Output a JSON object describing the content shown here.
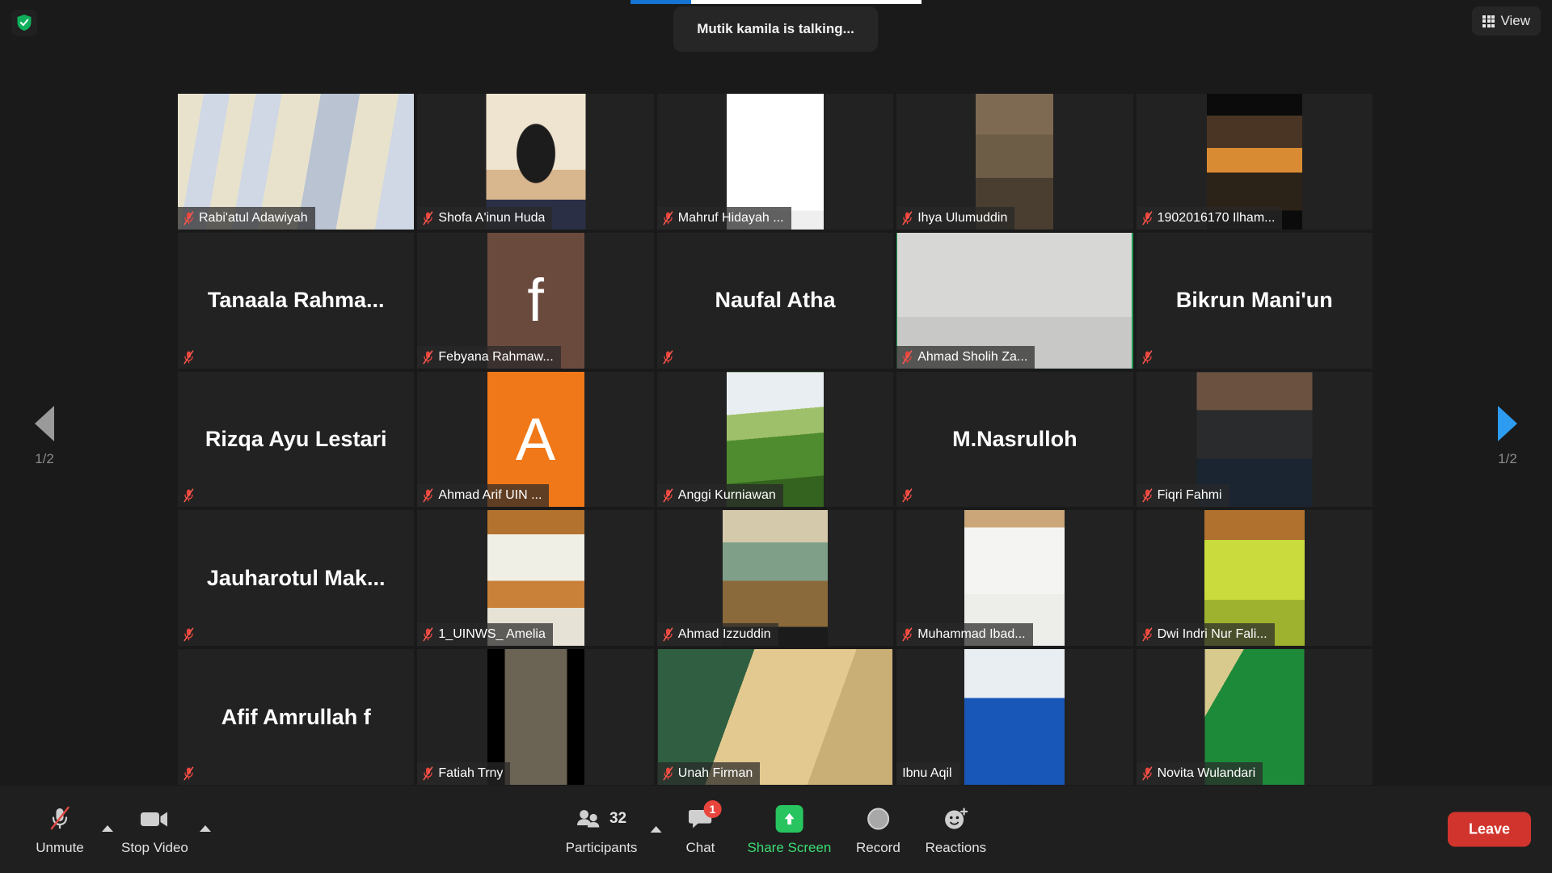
{
  "header": {
    "talking_notice": "Mutik kamila is talking...",
    "view_label": "View",
    "shield_icon": "security-shield-icon",
    "grid_icon": "grid-view-icon"
  },
  "navigation": {
    "prev_page_label": "1/2",
    "next_page_label": "1/2",
    "prev_icon": "triangle-left-icon",
    "next_icon": "triangle-right-icon"
  },
  "colors": {
    "accent_blue": "#2d9cf0",
    "share_green": "#27c460",
    "leave_red": "#d0342c",
    "mute_red": "#e8453c",
    "tile_bg": "#222222",
    "app_bg": "#1a1a1a",
    "toolbar_bg": "#1f1f1f"
  },
  "participants": [
    {
      "name": "Rabi'atul Adawiyah",
      "video": true,
      "muted": true,
      "speaking": false,
      "style": "photo-person-a",
      "media_w": 292,
      "name_truncated": false
    },
    {
      "name": "Shofa A'inun Huda",
      "video": true,
      "muted": true,
      "speaking": false,
      "style": "photo-person-b",
      "media_w": 123,
      "name_truncated": false
    },
    {
      "name": "Mahruf Hidayah ...",
      "video": true,
      "muted": true,
      "speaking": false,
      "style": "photo-doc-white",
      "media_w": 120,
      "name_truncated": true
    },
    {
      "name": "Ihya Ulumuddin",
      "video": true,
      "muted": true,
      "speaking": false,
      "style": "photo-outdoor-sit",
      "media_w": 96,
      "name_truncated": false
    },
    {
      "name": "1902016170 Ilham...",
      "video": true,
      "muted": true,
      "speaking": false,
      "style": "photo-sunset",
      "media_w": 118,
      "name_truncated": true
    },
    {
      "name": "Tanaala  Rahma...",
      "video": false,
      "muted": true,
      "speaking": false,
      "style": "name-only",
      "media_w": 0,
      "name_truncated": true
    },
    {
      "name": "Febyana Rahmaw...",
      "video": false,
      "muted": true,
      "speaking": false,
      "style": "avatar-letter-f",
      "avatar_letter": "f",
      "avatar_color": "#6b4a3e",
      "media_w": 120,
      "name_truncated": true
    },
    {
      "name": "Naufal Atha",
      "video": false,
      "muted": true,
      "speaking": false,
      "style": "name-only",
      "media_w": 0,
      "name_truncated": false
    },
    {
      "name": "Ahmad Sholih Za...",
      "video": true,
      "muted": true,
      "speaking": true,
      "style": "photo-person-cap",
      "media_w": 290,
      "name_truncated": true
    },
    {
      "name": "Bikrun Mani'un",
      "video": false,
      "muted": true,
      "speaking": false,
      "style": "name-only",
      "media_w": 0,
      "name_truncated": false
    },
    {
      "name": "Rizqa Ayu Lestari",
      "video": false,
      "muted": true,
      "speaking": false,
      "style": "name-only",
      "media_w": 0,
      "name_truncated": false
    },
    {
      "name": "Ahmad Arif UIN ...",
      "video": false,
      "muted": true,
      "speaking": false,
      "style": "avatar-letter-a",
      "avatar_letter": "A",
      "avatar_color": "#f07818",
      "media_w": 120,
      "name_truncated": true
    },
    {
      "name": "Anggi Kurniawan",
      "video": true,
      "muted": true,
      "speaking": false,
      "style": "photo-green-hill",
      "media_w": 120,
      "name_truncated": false
    },
    {
      "name": "M.Nasrulloh",
      "video": false,
      "muted": true,
      "speaking": false,
      "style": "name-only",
      "media_w": 0,
      "name_truncated": false
    },
    {
      "name": "Fiqri Fahmi",
      "video": true,
      "muted": true,
      "speaking": false,
      "style": "photo-study-boy",
      "media_w": 143,
      "name_truncated": false
    },
    {
      "name": "Jauharotul  Mak...",
      "video": false,
      "muted": true,
      "speaking": false,
      "style": "name-only",
      "media_w": 0,
      "name_truncated": true
    },
    {
      "name": "1_UINWS_ Amelia",
      "video": true,
      "muted": true,
      "speaking": false,
      "style": "photo-flowers",
      "media_w": 120,
      "name_truncated": false
    },
    {
      "name": "Ahmad Izzuddin",
      "video": true,
      "muted": true,
      "speaking": false,
      "style": "photo-tv-broadcast",
      "media_w": 130,
      "name_truncated": false
    },
    {
      "name": "Muhammad Ibad...",
      "video": true,
      "muted": true,
      "speaking": false,
      "style": "photo-white-room",
      "media_w": 124,
      "name_truncated": true
    },
    {
      "name": "Dwi Indri Nur Fali...",
      "video": true,
      "muted": true,
      "speaking": false,
      "style": "photo-pink-hijab",
      "media_w": 124,
      "name_truncated": true
    },
    {
      "name": "Afif Amrullah f",
      "video": false,
      "muted": true,
      "speaking": false,
      "style": "name-only",
      "media_w": 0,
      "name_truncated": false
    },
    {
      "name": "Fatiah Trny",
      "video": true,
      "muted": true,
      "speaking": false,
      "style": "photo-dark-portrait",
      "media_w": 120,
      "name_truncated": false
    },
    {
      "name": "Unah Firman",
      "video": true,
      "muted": true,
      "speaking": false,
      "style": "photo-green-wall",
      "media_w": 290,
      "name_truncated": false
    },
    {
      "name": "Ibnu Aqil",
      "video": true,
      "muted": false,
      "speaking": false,
      "style": "photo-blue-tarp",
      "media_w": 124,
      "name_truncated": false
    },
    {
      "name": "Novita Wulandari",
      "video": true,
      "muted": true,
      "speaking": false,
      "style": "photo-blue-hijab",
      "media_w": 123,
      "name_truncated": false
    }
  ],
  "toolbar": {
    "mic": {
      "label": "Unmute",
      "icon": "microphone-muted-icon",
      "has_caret": true
    },
    "video": {
      "label": "Stop Video",
      "icon": "video-camera-icon",
      "has_caret": true
    },
    "participants": {
      "label": "Participants",
      "count": "32",
      "icon": "people-icon",
      "has_caret": true
    },
    "chat": {
      "label": "Chat",
      "icon": "chat-bubble-icon",
      "badge": "1"
    },
    "share_screen": {
      "label": "Share Screen",
      "icon": "share-screen-up-arrow-icon"
    },
    "record": {
      "label": "Record",
      "icon": "record-circle-icon"
    },
    "reactions": {
      "label": "Reactions",
      "icon": "smiley-plus-icon"
    },
    "leave": {
      "label": "Leave"
    }
  }
}
